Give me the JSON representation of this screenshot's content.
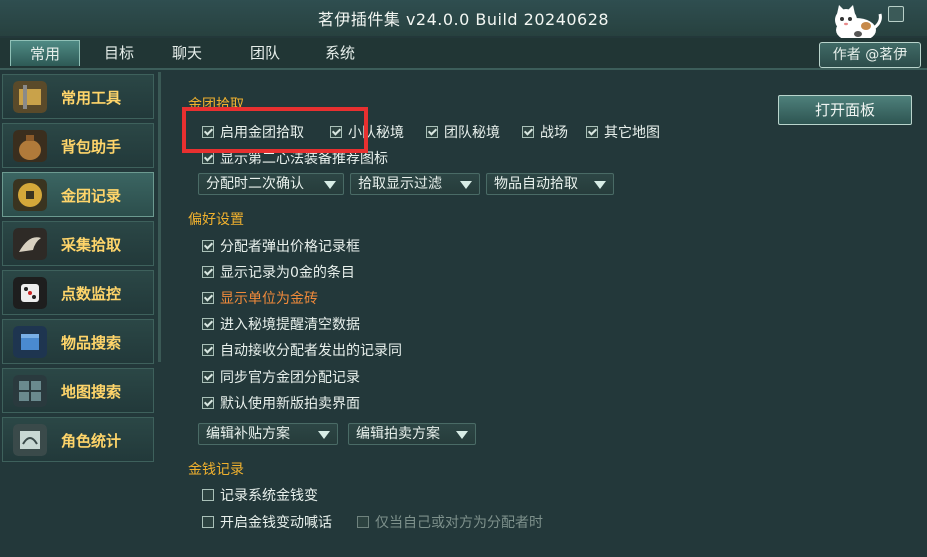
{
  "window": {
    "title": "茗伊插件集 v24.0.0 Build 20240628"
  },
  "tabs": [
    {
      "label": "常用",
      "active": true
    },
    {
      "label": "目标",
      "active": false
    },
    {
      "label": "聊天",
      "active": false
    },
    {
      "label": "团队",
      "active": false
    },
    {
      "label": "系统",
      "active": false
    }
  ],
  "author_button": "作者 @茗伊",
  "sidebar": {
    "items": [
      {
        "label": "常用工具",
        "icon": "tools-icon"
      },
      {
        "label": "背包助手",
        "icon": "bag-icon"
      },
      {
        "label": "金团记录",
        "icon": "coin-icon",
        "active": true
      },
      {
        "label": "采集拾取",
        "icon": "gather-icon"
      },
      {
        "label": "点数监控",
        "icon": "dice-icon"
      },
      {
        "label": "物品搜索",
        "icon": "item-search-icon"
      },
      {
        "label": "地图搜索",
        "icon": "map-search-icon"
      },
      {
        "label": "角色统计",
        "icon": "role-stats-icon"
      }
    ]
  },
  "main": {
    "open_panel_button": "打开面板",
    "loot": {
      "title": "金团拾取",
      "checkboxes": [
        {
          "label": "启用金团拾取",
          "checked": true
        },
        {
          "label": "小队秘境",
          "checked": true
        },
        {
          "label": "团队秘境",
          "checked": true
        },
        {
          "label": "战场",
          "checked": true
        },
        {
          "label": "其它地图",
          "checked": true
        }
      ],
      "show_icon": {
        "label": "显示第二心法装备推荐图标",
        "checked": true
      },
      "dropdowns": [
        {
          "label": "分配时二次确认"
        },
        {
          "label": "拾取显示过滤"
        },
        {
          "label": "物品自动拾取"
        }
      ]
    },
    "prefs": {
      "title": "偏好设置",
      "options": [
        {
          "label": "分配者弹出价格记录框",
          "checked": true
        },
        {
          "label": "显示记录为0金的条目",
          "checked": true
        },
        {
          "label": "显示单位为金砖",
          "checked": true,
          "highlight": true
        },
        {
          "label": "进入秘境提醒清空数据",
          "checked": true
        },
        {
          "label": "自动接收分配者发出的记录同",
          "checked": true
        },
        {
          "label": "同步官方金团分配记录",
          "checked": true
        },
        {
          "label": "默认使用新版拍卖界面",
          "checked": true
        }
      ],
      "dropdowns": [
        {
          "label": "编辑补贴方案"
        },
        {
          "label": "编辑拍卖方案"
        }
      ]
    },
    "money": {
      "title": "金钱记录",
      "option1": {
        "label": "记录系统金钱变",
        "checked": false
      },
      "option2": {
        "label": "开启金钱变动喊话",
        "checked": false
      },
      "option3": {
        "label": "仅当自己或对方为分配者时",
        "checked": false,
        "disabled": true
      }
    }
  },
  "colors": {
    "background": "#23383a",
    "section_title": "#f0b12e",
    "sidebar_label": "#ffd56a",
    "orange_option": "#f08a3a",
    "highlight_box": "#e83030"
  }
}
